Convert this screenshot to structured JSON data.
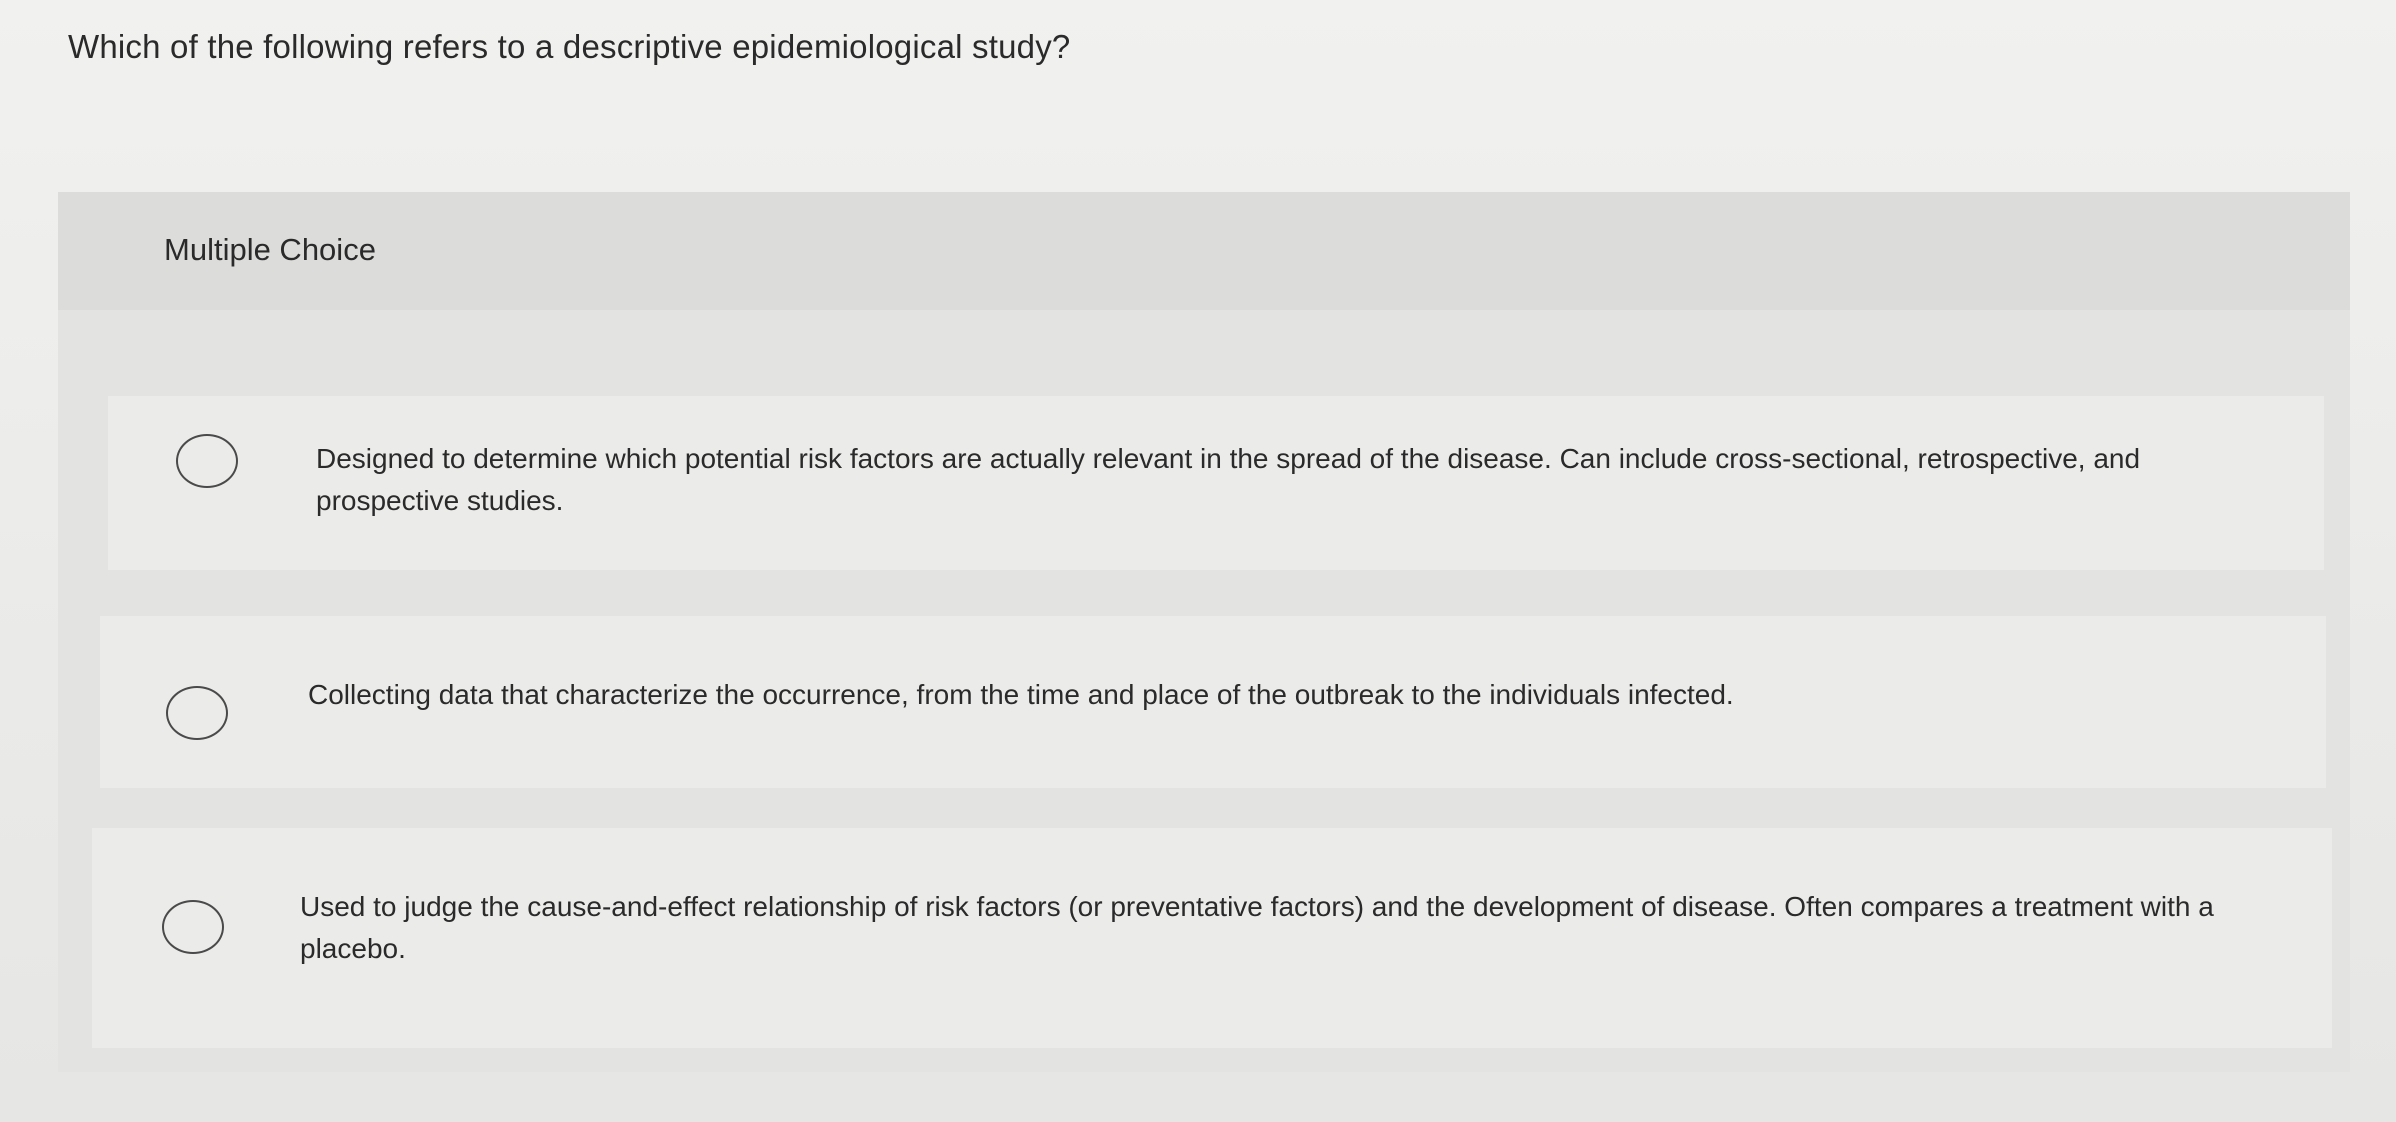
{
  "question": {
    "text": "Which of the following refers to a descriptive epidemiological study?"
  },
  "card": {
    "header_label": "Multiple Choice"
  },
  "options": [
    {
      "text": "Designed to determine which potential risk factors are actually relevant in the spread of the disease. Can include cross-sectional, retrospective, and prospective studies.",
      "selected": false
    },
    {
      "text": "Collecting data that characterize the occurrence, from the time and place of the outbreak to the individuals infected.",
      "selected": false
    },
    {
      "text": "Used to judge the cause-and-effect relationship of risk factors (or preventative factors) and the development of disease. Often compares a treatment with a placebo.",
      "selected": false
    }
  ]
}
